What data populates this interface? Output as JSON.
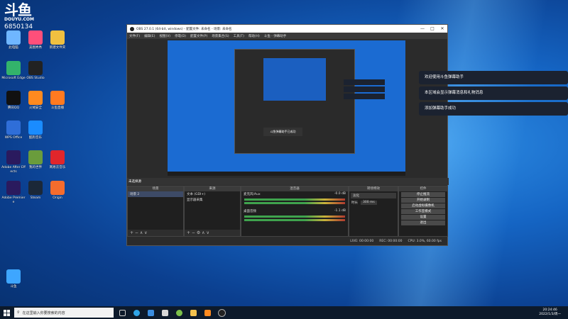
{
  "watermark": {
    "logo": "斗鱼",
    "sub": "DOUYU.COM",
    "room": "6850134"
  },
  "desktop_icons": [
    {
      "label": "此电脑",
      "color": "#6fb6ff"
    },
    {
      "label": "美图秀秀",
      "color": "#ff4f7a"
    },
    {
      "label": "新建文件夹",
      "color": "#f0c040"
    },
    {
      "label": "Microsoft Edge",
      "color": "#33b36b"
    },
    {
      "label": "OBS Studio",
      "color": "#222222"
    },
    {
      "label": "腾讯QQ",
      "color": "#111111"
    },
    {
      "label": "火绒安全",
      "color": "#ff8a1f"
    },
    {
      "label": "斗鱼直播",
      "color": "#ff7a20"
    },
    {
      "label": "WPS Office",
      "color": "#2f6ed8"
    },
    {
      "label": "酷狗音乐",
      "color": "#1a8cff"
    },
    {
      "label": "Adobe After Effects",
      "color": "#2a1a5e"
    },
    {
      "label": "我的世界",
      "color": "#6a9c3c"
    },
    {
      "label": "网易云音乐",
      "color": "#e0262b"
    },
    {
      "label": "Adobe Premiere",
      "color": "#2a1a5e"
    },
    {
      "label": "Steam",
      "color": "#1b2838"
    },
    {
      "label": "Origin",
      "color": "#f56c2d"
    },
    {
      "label": "斗鱼",
      "color": "#3ea6ff"
    }
  ],
  "obs": {
    "title": "OBS 27.0.1 (64-bit, windows) - 配置文件: 未命名 - 场景: 未命名",
    "menu": [
      "文件(F)",
      "编辑(E)",
      "视图(V)",
      "停靠(D)",
      "配置文件(P)",
      "场景集合(S)",
      "工具(T)",
      "帮助(H)",
      "斗鱼 - 弹幕助手"
    ],
    "preview_popup": "斗鱼弹幕助手已成功",
    "scene_bar": "未选择源",
    "docks": {
      "scenes": {
        "title": "场景",
        "items": [
          "场景 2"
        ]
      },
      "sources": {
        "title": "来源",
        "items": [
          "文本 (GDI+)",
          "显示器采集"
        ]
      },
      "mixer": {
        "title": "混音器",
        "channels": [
          {
            "name": "麦克风/Aux",
            "db": "-0.0 dB"
          },
          {
            "name": "桌面音频",
            "db": "-1.1 dB"
          }
        ]
      },
      "transitions": {
        "title": "转场特效",
        "type": "淡化",
        "duration_label": "时长",
        "duration": "300 ms"
      },
      "controls": {
        "title": "控件",
        "buttons": [
          "停止推流",
          "开始录制",
          "启动虚拟摄像机",
          "工作室模式",
          "设置",
          "退出"
        ]
      }
    },
    "status": {
      "live": "LIVE: 00:00:00",
      "rec": "REC: 00:00:00",
      "cpu": "CPU: 3.0%, 60.00 fps"
    }
  },
  "notifications": [
    "欢迎使用斗鱼弹幕助手",
    "本区域会显示弹幕消息和礼物消息",
    "添加弹幕助手成功"
  ],
  "taskbar": {
    "search_placeholder": "在这里输入你要搜索的内容",
    "time": "20:24:46",
    "date": "2022/1/3/周一"
  }
}
